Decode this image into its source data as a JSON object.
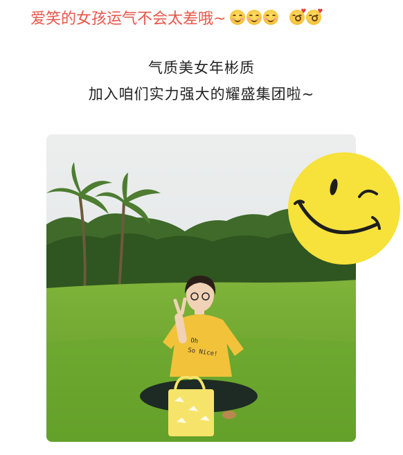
{
  "headline": {
    "text": "爱笑的女孩运气不会太差哦~",
    "color": "#e8564a",
    "emojis": [
      "smiling-face-icon",
      "smiling-face-icon",
      "smiling-face-icon",
      "kissing-face-icon",
      "kissing-face-icon"
    ]
  },
  "subtitle": {
    "line1": "气质美女年彬质",
    "line2": "加入咱们实力强大的耀盛集团啦~"
  },
  "photo": {
    "subject": "woman-sitting-on-grass",
    "shirt_text": "Oh So Nice!"
  },
  "sticker": {
    "icon": "winking-smiley-icon",
    "color": "#f6e23a"
  }
}
